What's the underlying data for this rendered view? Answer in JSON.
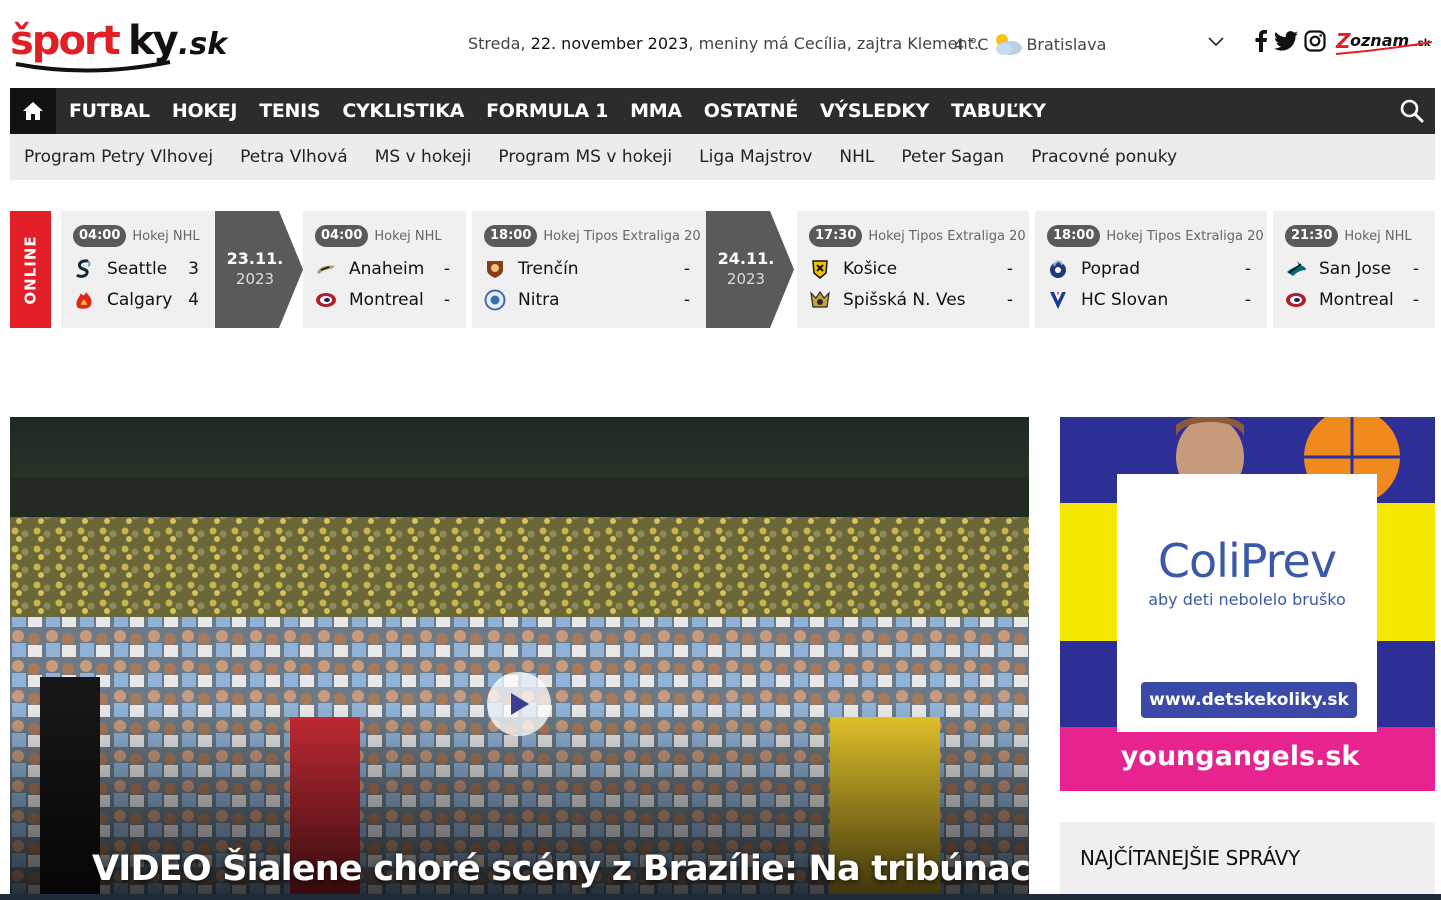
{
  "header": {
    "logo_text": "športky.sk",
    "date_prefix": "Streda,",
    "date_bold": "22. november 2023",
    "date_suffix": ", meniny má Cecília, zajtra Klement.",
    "weather_temp": "4 °C",
    "weather_city": "Bratislava",
    "weather_icon": "partly-cloudy-icon",
    "social": [
      "facebook-icon",
      "twitter-icon",
      "instagram-icon"
    ],
    "partner": "Zoznam.sk"
  },
  "main_nav": {
    "items": [
      "FUTBAL",
      "HOKEJ",
      "TENIS",
      "CYKLISTIKA",
      "FORMULA 1",
      "MMA",
      "OSTATNÉ",
      "VÝSLEDKY",
      "TABUĽKY"
    ]
  },
  "sub_nav": {
    "items": [
      "Program Petry Vlhovej",
      "Petra Vlhová",
      "MS v hokeji",
      "Program MS v hokeji",
      "Liga Majstrov",
      "NHL",
      "Peter Sagan",
      "Pracovné ponuky"
    ]
  },
  "scores": {
    "online_label": "ONLINE",
    "matches": [
      {
        "time": "04:00",
        "league": "Hokej NHL",
        "home": "Seattle",
        "home_score": "3",
        "away": "Calgary",
        "away_score": "4"
      },
      {
        "time": "04:00",
        "league": "Hokej NHL",
        "home": "Anaheim",
        "home_score": "-",
        "away": "Montreal",
        "away_score": "-"
      },
      {
        "time": "18:00",
        "league": "Hokej Tipos Extraliga 20",
        "home": "Trenčín",
        "home_score": "-",
        "away": "Nitra",
        "away_score": "-"
      },
      {
        "time": "17:30",
        "league": "Hokej Tipos Extraliga 20",
        "home": "Košice",
        "home_score": "-",
        "away": "Spišská N. Ves",
        "away_score": "-"
      },
      {
        "time": "18:00",
        "league": "Hokej Tipos Extraliga 20",
        "home": "Poprad",
        "home_score": "-",
        "away": "HC Slovan",
        "away_score": "-"
      },
      {
        "time": "21:30",
        "league": "Hokej NHL",
        "home": "San Jose",
        "home_score": "-",
        "away": "Montreal",
        "away_score": "-"
      }
    ],
    "dates": [
      {
        "day": "23.11.",
        "year": "2023"
      },
      {
        "day": "24.11.",
        "year": "2023"
      }
    ]
  },
  "hero": {
    "title": "VIDEO Šialene choré scény z Brazílie: Na tribúnach sa"
  },
  "ad": {
    "brand": "ColiPrev",
    "tagline": "aby deti nebolelo bruško",
    "url": "www.detskekoliky.sk",
    "sponsor": "youngangels.sk"
  },
  "sidebar": {
    "most_read_title": "NAJČÍTANEJŠIE SPRÁVY"
  },
  "colors": {
    "nav_bg": "#2c2c2c",
    "online_red": "#e21e26",
    "date_chevron": "#5a5a5a",
    "logo_red": "#e21e26"
  }
}
